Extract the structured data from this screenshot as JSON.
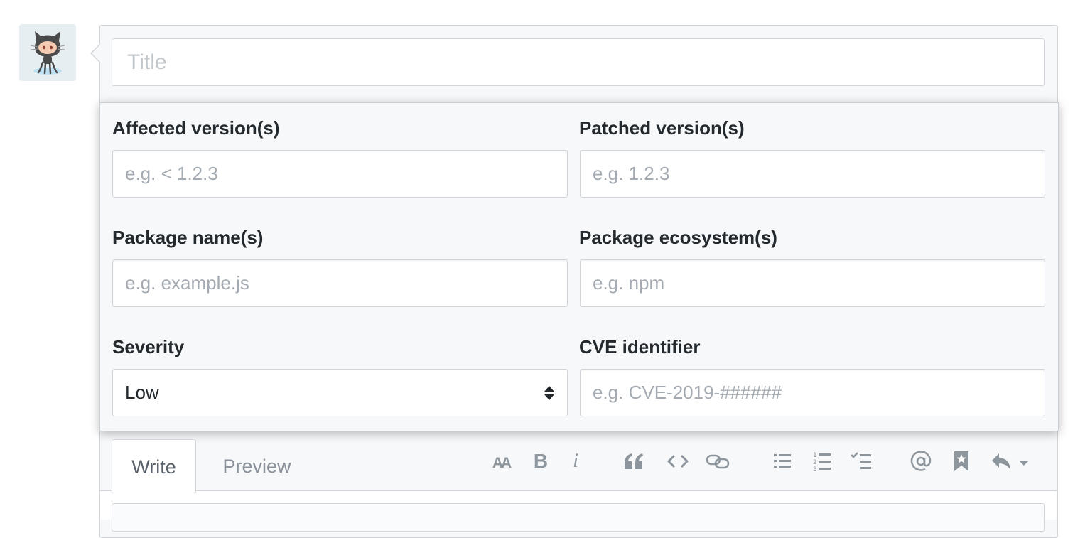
{
  "issue_form": {
    "title_placeholder": "Title",
    "fields": {
      "affected": {
        "label": "Affected version(s)",
        "placeholder": "e.g. < 1.2.3"
      },
      "patched": {
        "label": "Patched version(s)",
        "placeholder": "e.g. 1.2.3"
      },
      "package_name": {
        "label": "Package name(s)",
        "placeholder": "e.g. example.js"
      },
      "ecosystem": {
        "label": "Package ecosystem(s)",
        "placeholder": "e.g. npm"
      },
      "severity": {
        "label": "Severity",
        "value": "Low"
      },
      "cve": {
        "label": "CVE identifier",
        "placeholder": "e.g. CVE-2019-######"
      }
    }
  },
  "editor": {
    "tabs": {
      "write": "Write",
      "preview": "Preview"
    },
    "toolbar": {
      "heading_label": "AA",
      "bold_label": "B",
      "italic_label": "i",
      "icons": [
        "text-size-icon",
        "bold-icon",
        "italic-icon",
        "quote-icon",
        "code-icon",
        "link-icon",
        "unordered-list-icon",
        "ordered-list-icon",
        "task-list-icon",
        "mention-icon",
        "bookmark-icon",
        "reply-icon"
      ]
    }
  },
  "colors": {
    "border": "#d1d5da",
    "panel_bg": "#f6f8fa",
    "placeholder": "#a3aab1",
    "icon": "#8d959d"
  }
}
